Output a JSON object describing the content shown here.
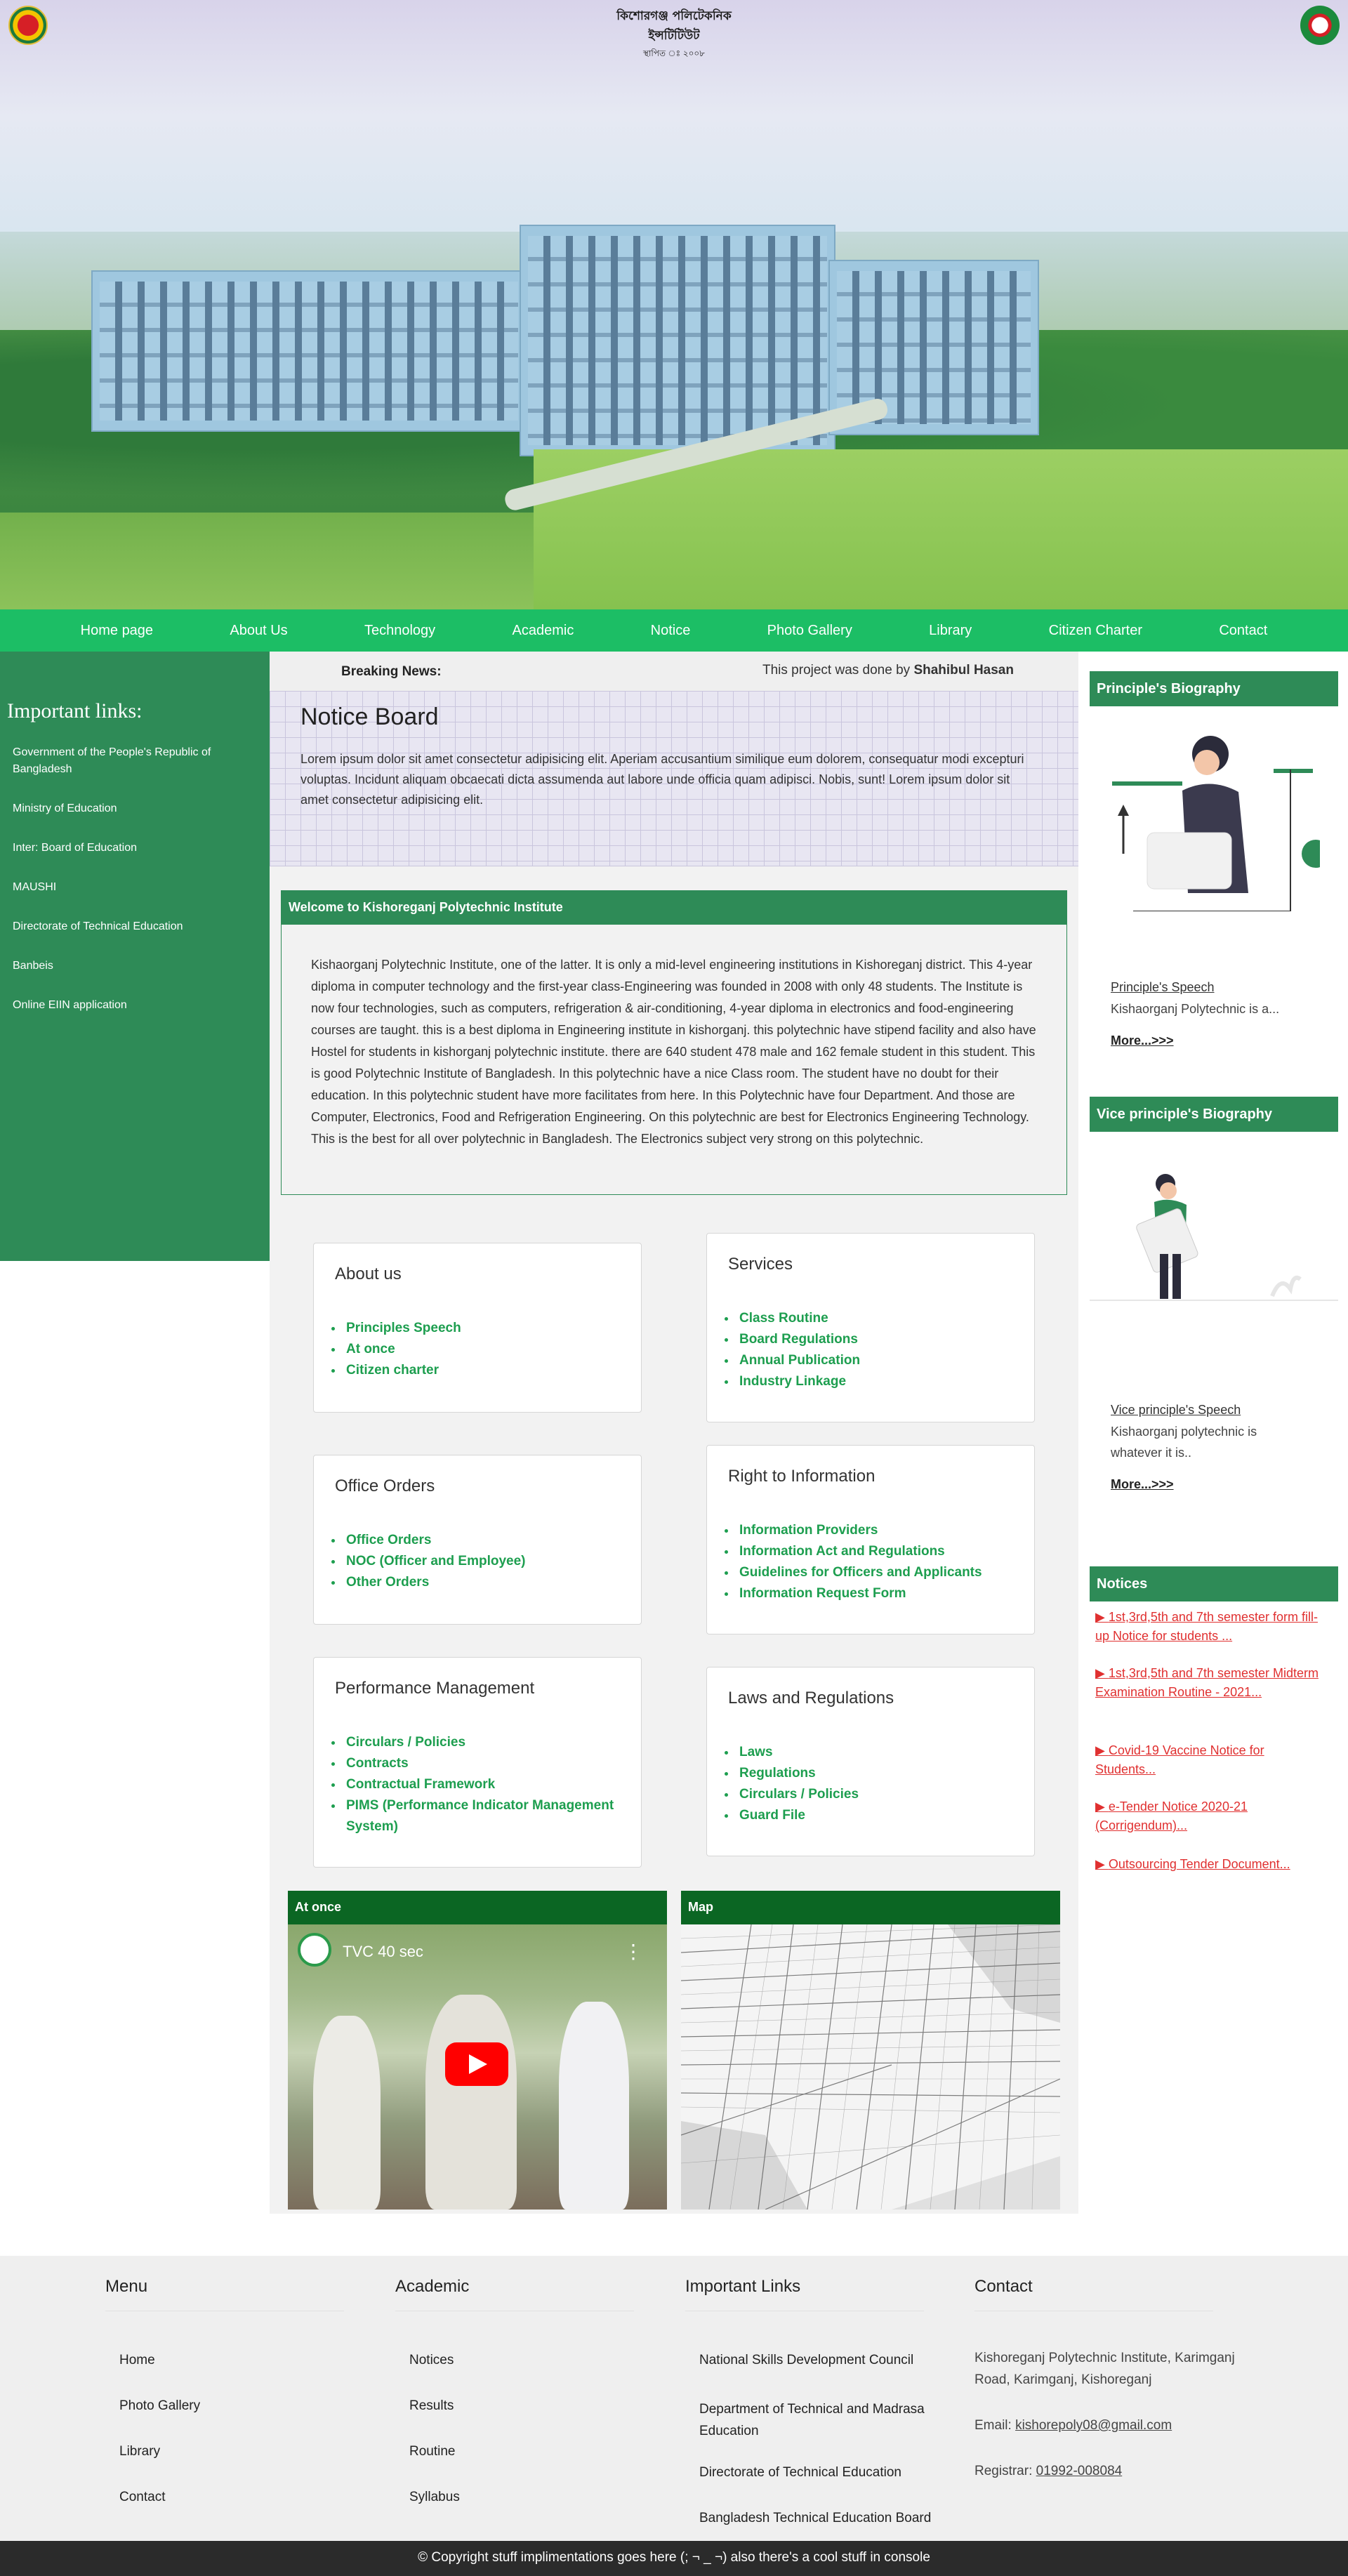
{
  "hero": {
    "institute_name_bn": "কিশোরগঞ্জ পলিটেকনিক ইন্সটিটিউট",
    "established_bn": "স্থাপিত ঃ ২০০৮"
  },
  "nav": [
    "Home page",
    "About Us",
    "Technology",
    "Academic",
    "Notice",
    "Photo Gallery",
    "Library",
    "Citizen Charter",
    "Contact"
  ],
  "sidebar": {
    "title": "Important links:",
    "links": [
      "Government of the People's Republic of Bangladesh",
      "Ministry of Education",
      "Inter: Board of Education",
      "MAUSHI",
      "Directorate of Technical Education",
      "Banbeis",
      "Online EIIN application"
    ]
  },
  "breaking": {
    "label": "Breaking News:",
    "project_prefix": "This project was done by ",
    "project_author": "Shahibul Hasan"
  },
  "notice_board": {
    "title": "Notice Board",
    "text": "Lorem ipsum dolor sit amet consectetur adipisicing elit. Aperiam accusantium similique eum dolorem, consequatur modi excepturi voluptas. Incidunt aliquam obcaecati dicta assumenda aut labore unde officia quam adipisci. Nobis, sunt! Lorem ipsum dolor sit amet consectetur adipisicing elit."
  },
  "welcome": {
    "title": "Welcome to Kishoreganj Polytechnic Institute",
    "text": "Kishaorganj Polytechnic Institute, one of the latter. It is only a mid-level engineering institutions in Kishoreganj district. This 4-year diploma in computer technology and the first-year class-Engineering was founded in 2008 with only 48 students. The Institute is now four technologies, such as computers, refrigeration & air-conditioning, 4-year diploma in electronics and food-engineering courses are taught. this is a best diploma in Engineering institute in kishorganj. this polytechnic have stipend facility and also have Hostel for students in kishorganj polytechnic institute. there are 640 student 478 male and 162 female student in this student. This is good Polytechnic Institute of Bangladesh. In this polytechnic have a nice Class room. The student have no doubt for their education. In this polytechnic student have more facilitates from here. In this Polytechnic have four Department. And those are Computer, Electronics, Food and Refrigeration Engineering. On this polytechnic are best for Electronics Engineering Technology. This is the best for all over polytechnic in Bangladesh. The Electronics subject very strong on this polytechnic."
  },
  "cards": {
    "about": {
      "title": "About us",
      "items": [
        "Principles Speech",
        "At once",
        "Citizen charter"
      ]
    },
    "services": {
      "title": "Services",
      "items": [
        "Class Routine",
        "Board Regulations",
        "Annual Publication",
        "Industry Linkage"
      ]
    },
    "office": {
      "title": "Office Orders",
      "items": [
        "Office Orders",
        "NOC (Officer and Employee)",
        "Other Orders"
      ]
    },
    "rti": {
      "title": "Right to Information",
      "items": [
        "Information Providers",
        "Information Act and Regulations",
        "Guidelines for Officers and Applicants",
        "Information Request Form"
      ]
    },
    "performance": {
      "title": "Performance Management",
      "items": [
        "Circulars / Policies",
        "Contracts",
        "Contractual Framework",
        "PIMS (Performance Indicator Management System)"
      ]
    },
    "laws": {
      "title": "Laws and Regulations",
      "items": [
        "Laws",
        "Regulations",
        "Circulars / Policies",
        "Guard File"
      ]
    }
  },
  "embeds": {
    "at_once_title": "At once",
    "video_title": "TVC 40 sec",
    "map_title": "Map"
  },
  "right": {
    "principal_header": "Principle's Biography",
    "principal_link": "Principle's Speech",
    "principal_text": "Kishaorganj Polytechnic is a...",
    "more": "More...>>>",
    "vice_header": "Vice principle's Biography",
    "vice_link": "Vice principle's Speech",
    "vice_text": "Kishaorganj polytechnic is whatever it is..",
    "notices_header": "Notices",
    "notices": [
      "1st,3rd,5th and 7th semester form fill-up Notice for students ...",
      "1st,3rd,5th and 7th semester Midterm Examination Routine - 2021...",
      "Covid-19 Vaccine Notice for Students...",
      "e-Tender Notice 2020-21 (Corrigendum)...",
      "Outsourcing Tender Document..."
    ]
  },
  "footer": {
    "menu": {
      "title": "Menu",
      "links": [
        "Home",
        "Photo Gallery",
        "Library",
        "Contact"
      ]
    },
    "academic": {
      "title": "Academic",
      "links": [
        "Notices",
        "Results",
        "Routine",
        "Syllabus"
      ]
    },
    "important": {
      "title": "Important Links",
      "links": [
        "National Skills Development Council",
        "Department of Technical and Madrasa Education",
        "Directorate of Technical Education",
        "Bangladesh Technical Education Board"
      ]
    },
    "contact": {
      "title": "Contact",
      "address": "Kishoreganj Polytechnic Institute, Karimganj Road, Karimganj, Kishoreganj",
      "email_label": "Email: ",
      "email": "kishorepoly08@gmail.com",
      "registrar_label": "Registrar: ",
      "registrar_phone": "01992-008084"
    },
    "copyright": "© Copyright stuff implimentations goes here   (; ¬ _ ¬)   also there's a cool stuff in console"
  },
  "colors": {
    "nav": "#1cbe65",
    "sidebar": "#2e8b57",
    "accent_green": "#1d9e4f",
    "notice_red": "#e03030",
    "footer_bar": "#2b2b2b"
  }
}
